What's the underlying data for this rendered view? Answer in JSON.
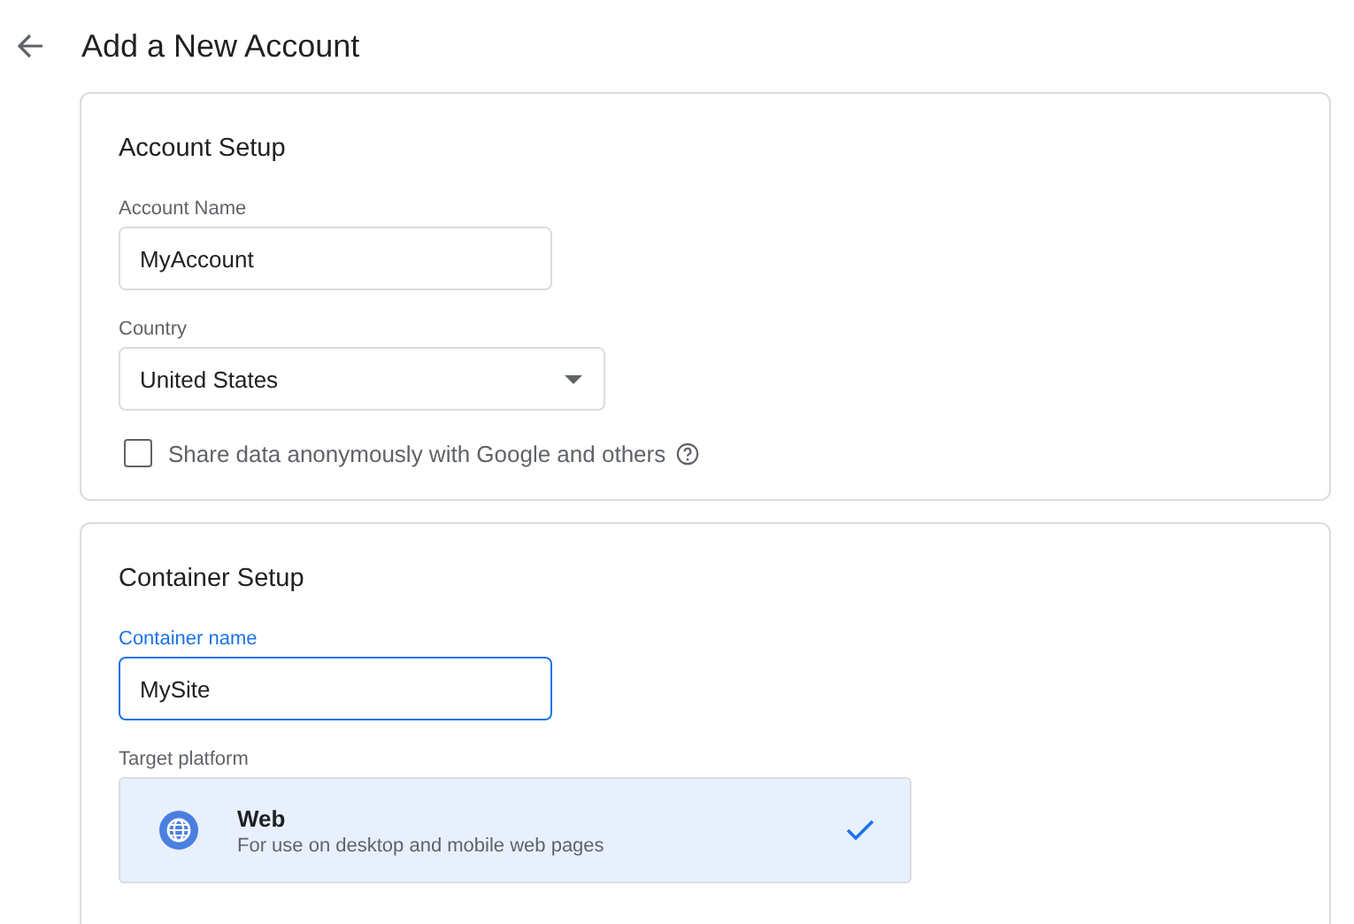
{
  "page": {
    "title": "Add a New Account"
  },
  "account_setup": {
    "title": "Account Setup",
    "account_name": {
      "label": "Account Name",
      "value": "MyAccount",
      "focused": false
    },
    "country": {
      "label": "Country",
      "value": "United States"
    },
    "share_data": {
      "label": "Share data anonymously with Google and others",
      "checked": false
    }
  },
  "container_setup": {
    "title": "Container Setup",
    "container_name": {
      "label": "Container name",
      "value": "MySite",
      "focused": true
    },
    "target_platform": {
      "label": "Target platform",
      "options": [
        {
          "title": "Web",
          "description": "For use on desktop and mobile web pages",
          "selected": true
        }
      ]
    }
  }
}
